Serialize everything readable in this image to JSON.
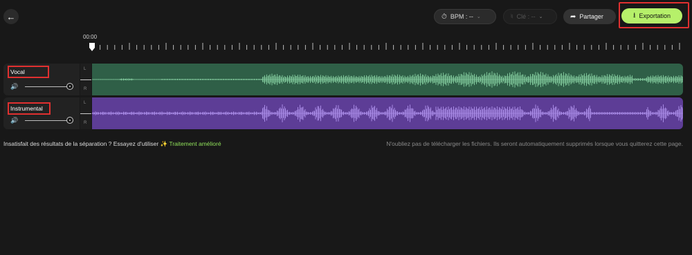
{
  "header": {
    "bpm_label": "BPM : --",
    "key_label": "Clé : --",
    "share_label": "Partager",
    "export_label": "Exportation"
  },
  "timeline": {
    "start_time": "00:00"
  },
  "tracks": [
    {
      "name": "Vocal",
      "left_label": "L",
      "right_label": "R",
      "color": "#2f5f47",
      "wave_color": "#7fc79a"
    },
    {
      "name": "Instrumental",
      "left_label": "L",
      "right_label": "R",
      "color": "#5d3d96",
      "wave_color": "#a98be6"
    }
  ],
  "footer": {
    "prompt": "Insatisfait des résultats de la séparation ? Essayez d'utiliser",
    "enhanced_link": "✨ Traitement amélioré",
    "notice": "N'oubliez pas de télécharger les fichiers. Ils seront automatiquement supprimés lorsque vous quitterez cette page."
  },
  "icons": {
    "back": "arrow-left-icon",
    "bpm": "metronome-icon",
    "key": "key-icon",
    "share": "share-arrow-icon",
    "export": "download-icon",
    "volume": "speaker-icon"
  }
}
